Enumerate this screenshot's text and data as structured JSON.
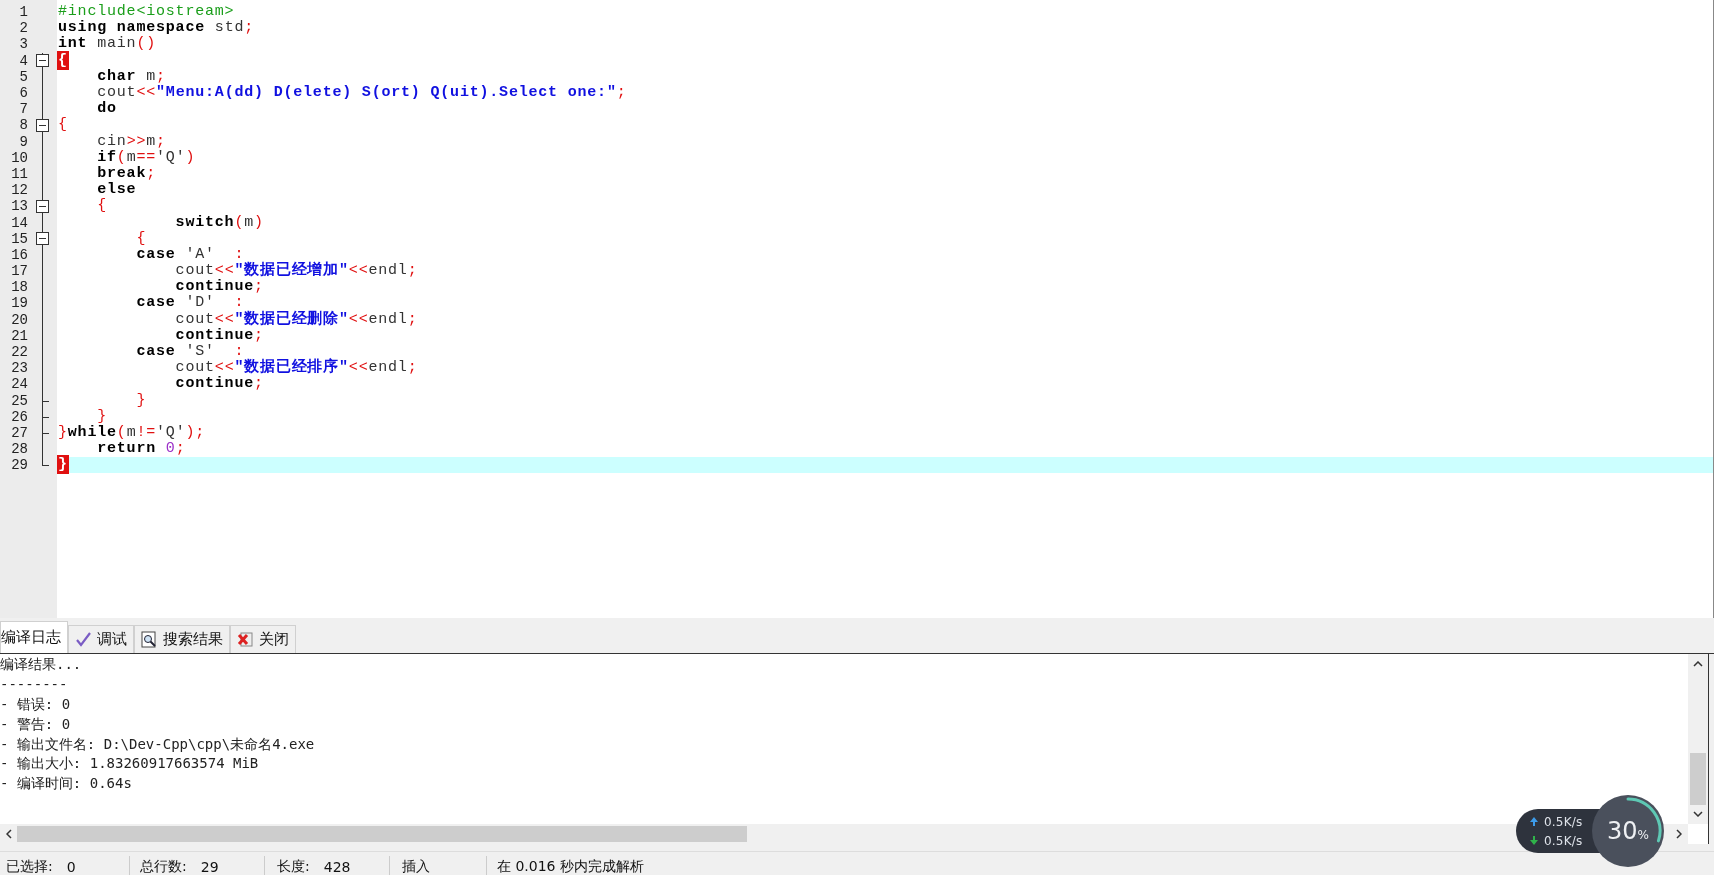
{
  "editor": {
    "lines": [
      {
        "number": "1",
        "kind": "plain",
        "current": false,
        "tokens": [
          {
            "kind": "pp",
            "text": "#include<iostream>"
          }
        ]
      },
      {
        "number": "2",
        "kind": "plain",
        "current": false,
        "tokens": [
          {
            "kind": "kw",
            "text": "using namespace"
          },
          {
            "kind": "plain",
            "text": " std"
          },
          {
            "kind": "op",
            "text": ";"
          }
        ]
      },
      {
        "number": "3",
        "kind": "plain",
        "current": false,
        "tokens": [
          {
            "kind": "kw",
            "text": "int"
          },
          {
            "kind": "plain",
            "text": " main"
          },
          {
            "kind": "op",
            "text": "()"
          }
        ]
      },
      {
        "number": "4",
        "kind": "fold-start",
        "current": false,
        "tokens": [
          {
            "kind": "match",
            "text": "{"
          }
        ]
      },
      {
        "number": "5",
        "kind": "fold-body",
        "current": false,
        "tokens": [
          {
            "kind": "kw",
            "text": "    char"
          },
          {
            "kind": "plain",
            "text": " m"
          },
          {
            "kind": "op",
            "text": ";"
          }
        ]
      },
      {
        "number": "6",
        "kind": "fold-body",
        "current": false,
        "tokens": [
          {
            "kind": "plain",
            "text": "    cout"
          },
          {
            "kind": "op",
            "text": "<<"
          },
          {
            "kind": "str",
            "text": "\"Menu:A(dd) D(elete) S(ort) Q(uit).Select one:\""
          },
          {
            "kind": "op",
            "text": ";"
          }
        ]
      },
      {
        "number": "7",
        "kind": "fold-body",
        "current": false,
        "tokens": [
          {
            "kind": "kw",
            "text": "    do"
          }
        ]
      },
      {
        "number": "8",
        "kind": "fold-start",
        "current": false,
        "tokens": [
          {
            "kind": "op",
            "text": "{"
          }
        ]
      },
      {
        "number": "9",
        "kind": "fold-body",
        "current": false,
        "tokens": [
          {
            "kind": "plain",
            "text": "    cin"
          },
          {
            "kind": "op",
            "text": ">>"
          },
          {
            "kind": "plain",
            "text": "m"
          },
          {
            "kind": "op",
            "text": ";"
          }
        ]
      },
      {
        "number": "10",
        "kind": "fold-body",
        "current": false,
        "tokens": [
          {
            "kind": "kw",
            "text": "    if"
          },
          {
            "kind": "op",
            "text": "("
          },
          {
            "kind": "plain",
            "text": "m"
          },
          {
            "kind": "op",
            "text": "=="
          },
          {
            "kind": "plain",
            "text": "'Q'"
          },
          {
            "kind": "op",
            "text": ")"
          }
        ]
      },
      {
        "number": "11",
        "kind": "fold-body",
        "current": false,
        "tokens": [
          {
            "kind": "kw",
            "text": "    break"
          },
          {
            "kind": "op",
            "text": ";"
          }
        ]
      },
      {
        "number": "12",
        "kind": "fold-body",
        "current": false,
        "tokens": [
          {
            "kind": "kw",
            "text": "    else"
          }
        ]
      },
      {
        "number": "13",
        "kind": "fold-start",
        "current": false,
        "tokens": [
          {
            "kind": "op",
            "text": "    {"
          }
        ]
      },
      {
        "number": "14",
        "kind": "fold-body",
        "current": false,
        "tokens": [
          {
            "kind": "kw",
            "text": "            switch"
          },
          {
            "kind": "op",
            "text": "("
          },
          {
            "kind": "plain",
            "text": "m"
          },
          {
            "kind": "op",
            "text": ")"
          }
        ]
      },
      {
        "number": "15",
        "kind": "fold-start",
        "current": false,
        "tokens": [
          {
            "kind": "op",
            "text": "        {"
          }
        ]
      },
      {
        "number": "16",
        "kind": "fold-body",
        "current": false,
        "tokens": [
          {
            "kind": "kw",
            "text": "        case"
          },
          {
            "kind": "plain",
            "text": " 'A'  "
          },
          {
            "kind": "op",
            "text": ":"
          }
        ]
      },
      {
        "number": "17",
        "kind": "fold-body",
        "current": false,
        "tokens": [
          {
            "kind": "plain",
            "text": "            cout"
          },
          {
            "kind": "op",
            "text": "<<"
          },
          {
            "kind": "str",
            "text": "\"数据已经增加\""
          },
          {
            "kind": "op",
            "text": "<<"
          },
          {
            "kind": "plain",
            "text": "endl"
          },
          {
            "kind": "op",
            "text": ";"
          }
        ]
      },
      {
        "number": "18",
        "kind": "fold-body",
        "current": false,
        "tokens": [
          {
            "kind": "kw",
            "text": "            continue"
          },
          {
            "kind": "op",
            "text": ";"
          }
        ]
      },
      {
        "number": "19",
        "kind": "fold-body",
        "current": false,
        "tokens": [
          {
            "kind": "kw",
            "text": "        case"
          },
          {
            "kind": "plain",
            "text": " 'D'  "
          },
          {
            "kind": "op",
            "text": ":"
          }
        ]
      },
      {
        "number": "20",
        "kind": "fold-body",
        "current": false,
        "tokens": [
          {
            "kind": "plain",
            "text": "            cout"
          },
          {
            "kind": "op",
            "text": "<<"
          },
          {
            "kind": "str",
            "text": "\"数据已经删除\""
          },
          {
            "kind": "op",
            "text": "<<"
          },
          {
            "kind": "plain",
            "text": "endl"
          },
          {
            "kind": "op",
            "text": ";"
          }
        ]
      },
      {
        "number": "21",
        "kind": "fold-body",
        "current": false,
        "tokens": [
          {
            "kind": "kw",
            "text": "            continue"
          },
          {
            "kind": "op",
            "text": ";"
          }
        ]
      },
      {
        "number": "22",
        "kind": "fold-body",
        "current": false,
        "tokens": [
          {
            "kind": "kw",
            "text": "        case"
          },
          {
            "kind": "plain",
            "text": " 'S'  "
          },
          {
            "kind": "op",
            "text": ":"
          }
        ]
      },
      {
        "number": "23",
        "kind": "fold-body",
        "current": false,
        "tokens": [
          {
            "kind": "plain",
            "text": "            cout"
          },
          {
            "kind": "op",
            "text": "<<"
          },
          {
            "kind": "str",
            "text": "\"数据已经排序\""
          },
          {
            "kind": "op",
            "text": "<<"
          },
          {
            "kind": "plain",
            "text": "endl"
          },
          {
            "kind": "op",
            "text": ";"
          }
        ]
      },
      {
        "number": "24",
        "kind": "fold-body",
        "current": false,
        "tokens": [
          {
            "kind": "kw",
            "text": "            continue"
          },
          {
            "kind": "op",
            "text": ";"
          }
        ]
      },
      {
        "number": "25",
        "kind": "fold-end",
        "current": false,
        "tokens": [
          {
            "kind": "op",
            "text": "        }"
          }
        ]
      },
      {
        "number": "26",
        "kind": "fold-end",
        "current": false,
        "tokens": [
          {
            "kind": "op",
            "text": "    }"
          }
        ]
      },
      {
        "number": "27",
        "kind": "fold-end",
        "current": false,
        "tokens": [
          {
            "kind": "op",
            "text": "}"
          },
          {
            "kind": "kw",
            "text": "while"
          },
          {
            "kind": "op",
            "text": "("
          },
          {
            "kind": "plain",
            "text": "m"
          },
          {
            "kind": "op",
            "text": "!="
          },
          {
            "kind": "plain",
            "text": "'Q'"
          },
          {
            "kind": "op",
            "text": ");"
          }
        ]
      },
      {
        "number": "28",
        "kind": "fold-body",
        "current": false,
        "tokens": [
          {
            "kind": "kw",
            "text": "    return"
          },
          {
            "kind": "num",
            "text": " 0"
          },
          {
            "kind": "op",
            "text": ";"
          }
        ]
      },
      {
        "number": "29",
        "kind": "fold-last",
        "current": true,
        "tokens": [
          {
            "kind": "match",
            "text": "}"
          }
        ]
      }
    ]
  },
  "bottom_tabs": [
    {
      "label": "编译日志",
      "selected": true
    },
    {
      "label": "调试",
      "selected": false
    },
    {
      "label": "搜索结果",
      "selected": false
    },
    {
      "label": "关闭",
      "selected": false
    }
  ],
  "log": [
    "编译结果...",
    "--------",
    "- 错误: 0",
    "- 警告: 0",
    "- 输出文件名: D:\\Dev-Cpp\\cpp\\未命名4.exe",
    "- 输出大小: 1.83260917663574 MiB",
    "- 编译时间: 0.64s"
  ],
  "status_bar": [
    {
      "label": "已选择:",
      "value": "0"
    },
    {
      "label": "总行数:",
      "value": "29"
    },
    {
      "label": "长度:",
      "value": "428"
    },
    {
      "label": "插入"
    },
    {
      "label": "在 0.016 秒内完成解析"
    }
  ],
  "net_widget": {
    "upload": "0.5K/s",
    "download": "0.5K/s",
    "percent": "30",
    "percent_unit": "%"
  }
}
